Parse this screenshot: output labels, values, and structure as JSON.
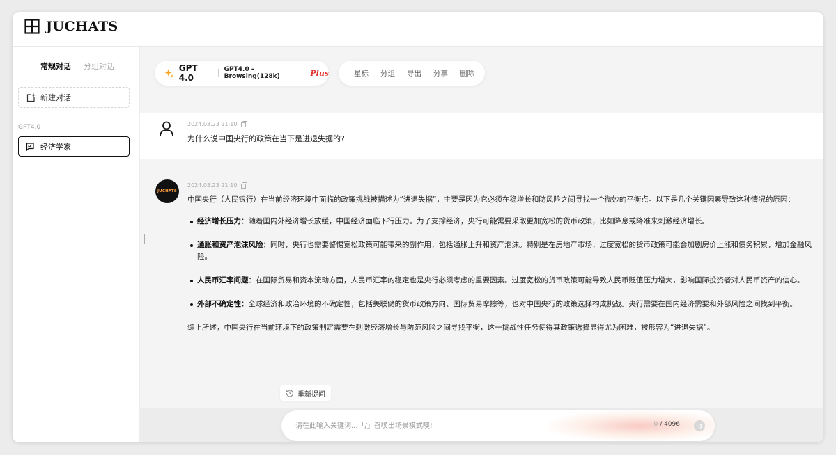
{
  "app": {
    "title": "JUCHATS"
  },
  "sidebar": {
    "tabs": [
      {
        "label": "常规对话",
        "active": true
      },
      {
        "label": "分组对话",
        "active": false
      }
    ],
    "new_chat_label": "新建对话",
    "group_label": "GPT4.0",
    "items": [
      {
        "label": "经济学家",
        "selected": true
      }
    ]
  },
  "toolbar": {
    "model_name": "GPT 4.0",
    "model_variant": "GPT4.0 - Browsing(128k)",
    "plan_badge": "Plus",
    "actions": [
      "星标",
      "分组",
      "导出",
      "分享",
      "删除"
    ]
  },
  "conversation": {
    "user_message": {
      "timestamp": "2024.03.23 21:10",
      "text": "为什么说中国央行的政策在当下是进退失据的?"
    },
    "assistant_message": {
      "avatar_text": "JUCHATS",
      "timestamp": "2024.03.23 21:10",
      "intro": "中国央行（人民银行）在当前经济环境中面临的政策挑战被描述为“进退失据”，主要是因为它必须在稳增长和防风险之间寻找一个微妙的平衡点。以下是几个关键因素导致这种情况的原因：",
      "points": [
        {
          "title": "经济增长压力",
          "text": "：随着国内外经济增长放缓，中国经济面临下行压力。为了支撑经济，央行可能需要采取更加宽松的货币政策，比如降息或降准来刺激经济增长。"
        },
        {
          "title": "通胀和资产泡沫风险",
          "text": "：同时，央行也需要警惕宽松政策可能带来的副作用，包括通胀上升和资产泡沫。特别是在房地产市场，过度宽松的货币政策可能会加剧房价上涨和债务积累，增加金融风险。"
        },
        {
          "title": "人民币汇率问题",
          "text": "：在国际贸易和资本流动方面，人民币汇率的稳定也是央行必须考虑的重要因素。过度宽松的货币政策可能导致人民币贬值压力增大，影响国际投资者对人民币资产的信心。"
        },
        {
          "title": "外部不确定性",
          "text": "：全球经济和政治环境的不确定性，包括美联储的货币政策方向、国际贸易摩擦等，也对中国央行的政策选择构成挑战。央行需要在国内经济需要和外部风险之间找到平衡。"
        }
      ],
      "summary": "综上所述，中国央行在当前环境下的政策制定需要在刺激经济增长与防范风险之间寻找平衡，这一挑战性任务使得其政策选择显得尤为困难，被形容为“进退失据”。"
    }
  },
  "regenerate_label": "重新提问",
  "input": {
    "placeholder": "请在此输入关键词...「/」召唤出场景模式噢!",
    "value": "",
    "char_count": "0",
    "char_limit": "/ 4096"
  },
  "colors": {
    "plus_badge": "#e0322f",
    "accent_star": "#f5a623",
    "selected_border": "#111111"
  }
}
